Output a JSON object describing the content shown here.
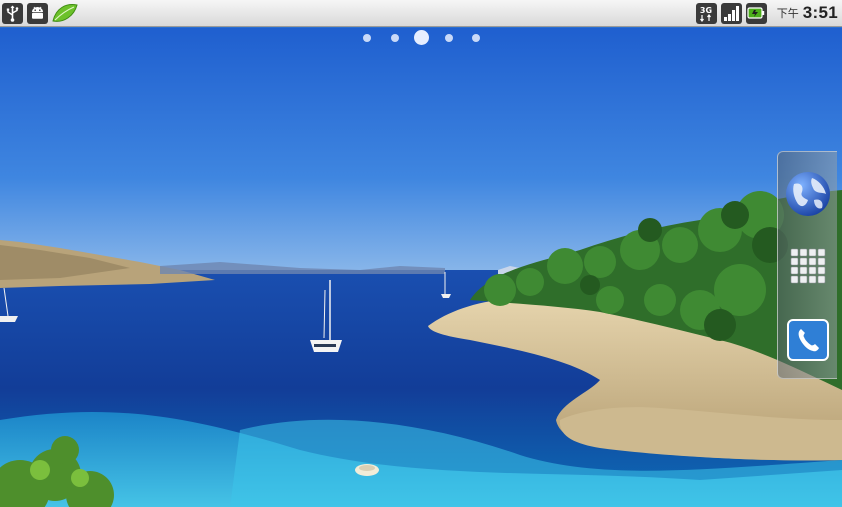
{
  "status_bar": {
    "left_icons": [
      "usb-icon",
      "android-debug-icon",
      "leaf-notification-icon"
    ],
    "right_icons": [
      "network-3g-icon",
      "signal-strength-icon",
      "battery-icon"
    ],
    "clock_period": "下午",
    "clock_time": "3:51"
  },
  "home": {
    "pages": {
      "count": 5,
      "current": 3
    },
    "dock": [
      {
        "name": "browser",
        "icon": "globe-icon"
      },
      {
        "name": "app-drawer",
        "icon": "grid-icon"
      },
      {
        "name": "phone",
        "icon": "phone-icon"
      }
    ]
  },
  "colors": {
    "sky": "#2f72d6",
    "sea": "#1545a8",
    "lagoon": "#23a8d8",
    "status_bar": "#e6e6e6",
    "battery": "#4caf1a"
  }
}
